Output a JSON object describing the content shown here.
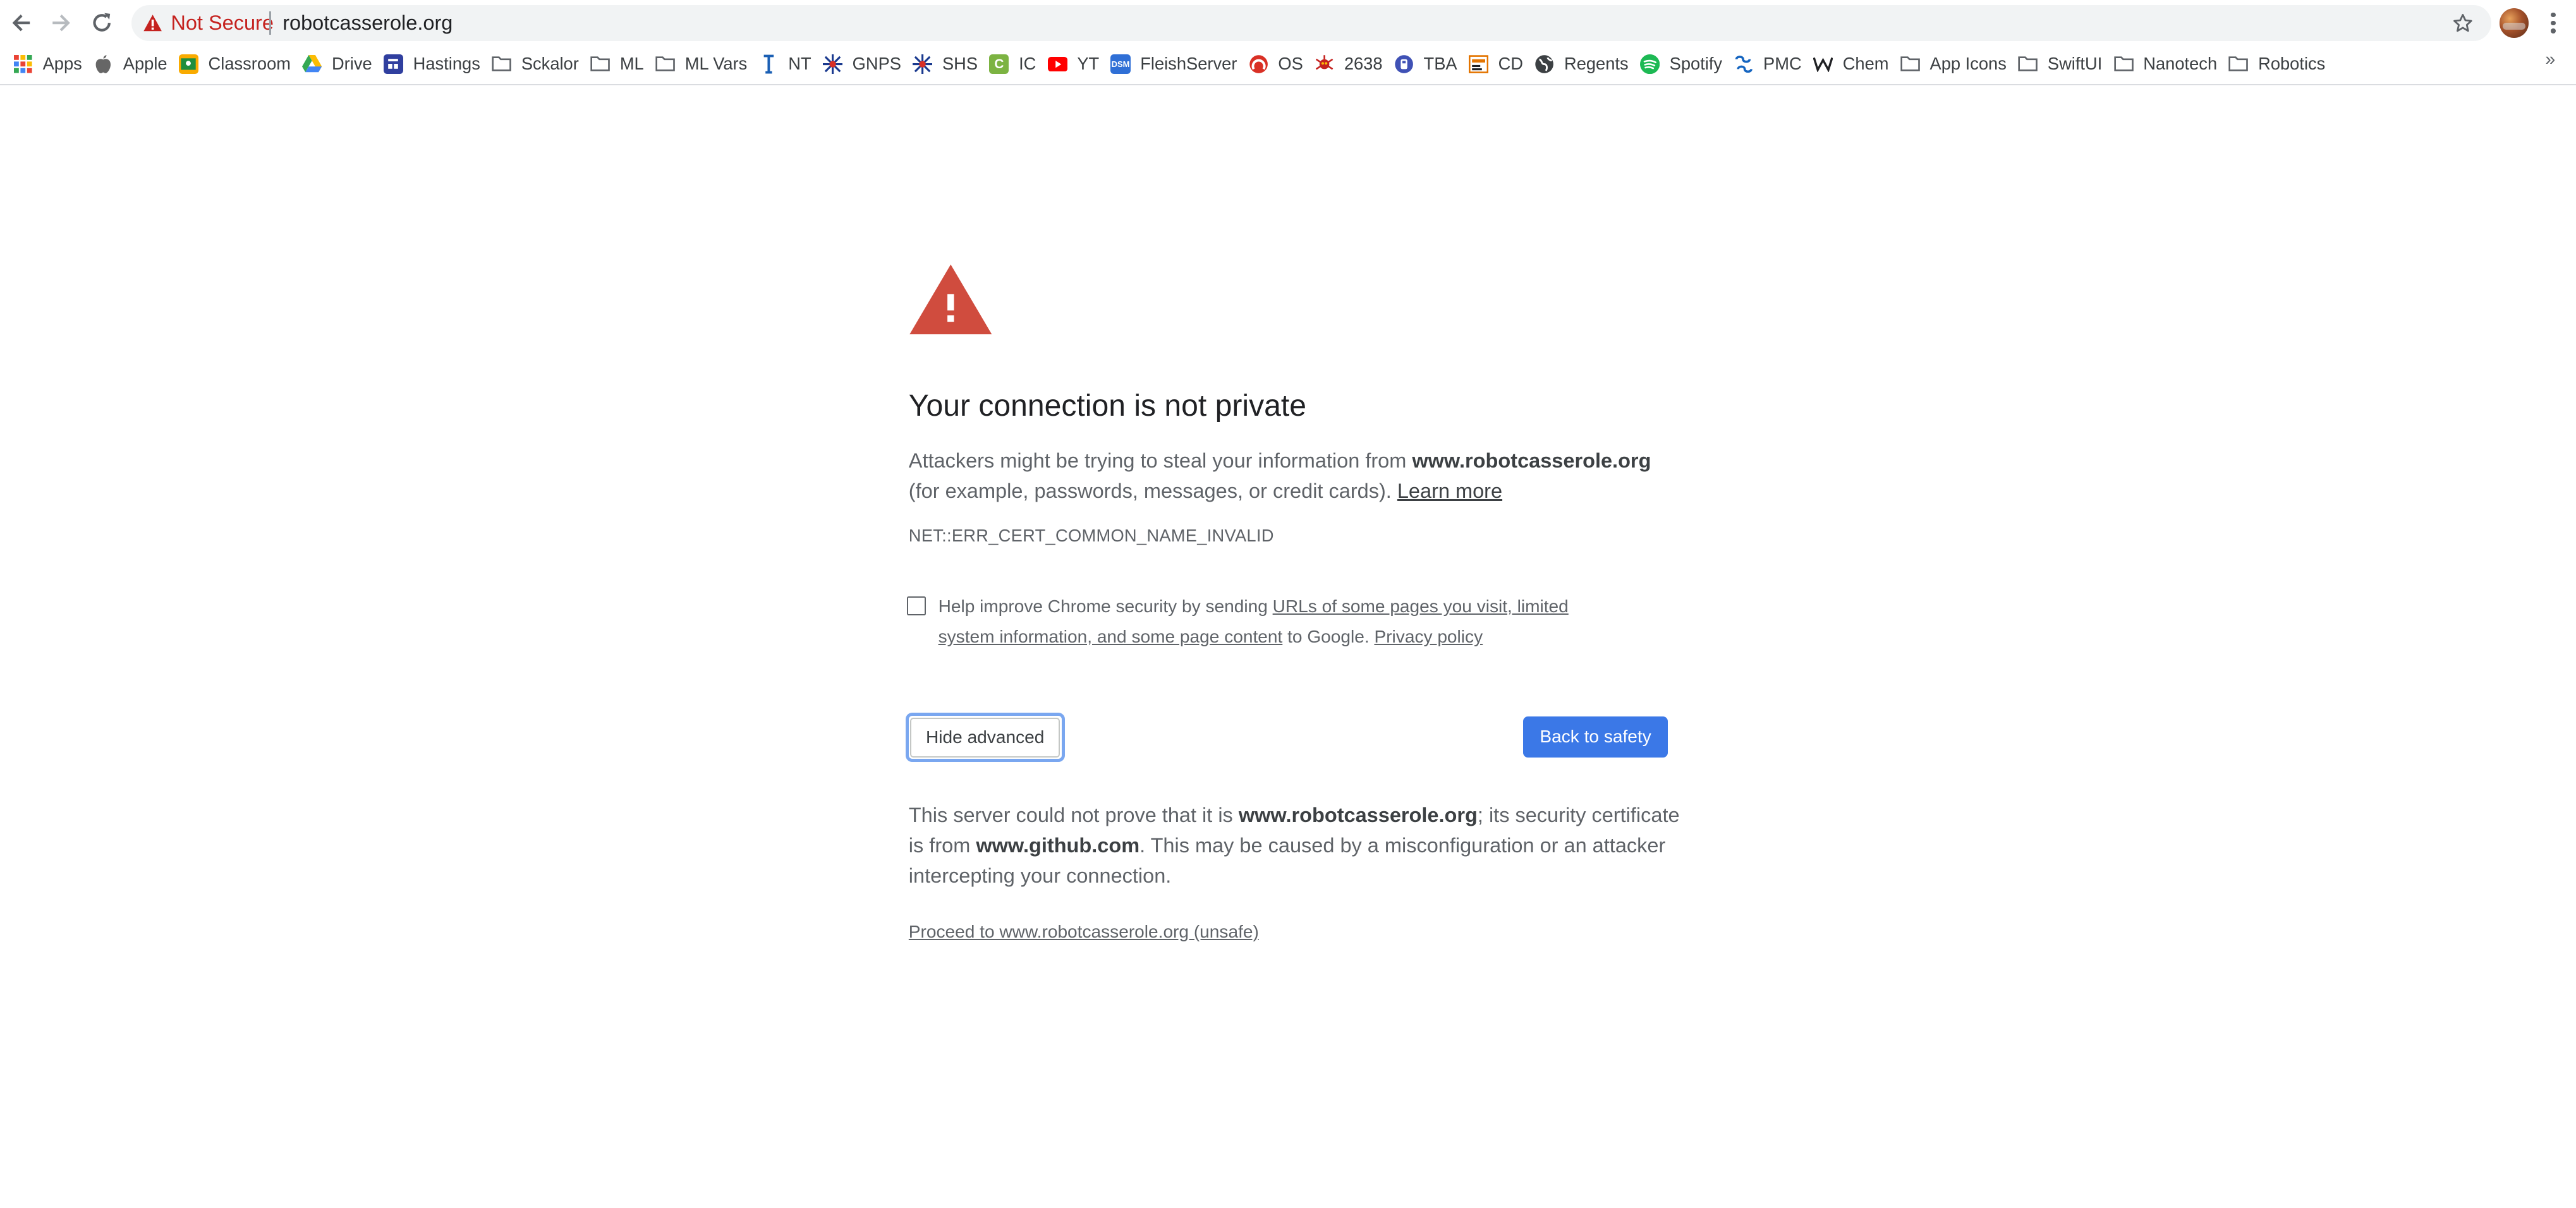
{
  "colors": {
    "not_secure": "#c5221f",
    "warning_red": "#d04c3e",
    "primary_button": "#3b78e7",
    "focus_ring": "#7aa7f0"
  },
  "toolbar": {
    "back_icon": "arrow-left",
    "forward_icon": "arrow-right",
    "reload_icon": "reload",
    "security_label": "Not Secure",
    "url": "robotcasserole.org",
    "bookmark_icon": "star-outline",
    "menu_icon": "vertical-dots"
  },
  "bookmarks": [
    {
      "label": "Apps",
      "icon": "apps-grid"
    },
    {
      "label": "Apple",
      "icon": "apple-logo"
    },
    {
      "label": "Classroom",
      "icon": "classroom"
    },
    {
      "label": "Drive",
      "icon": "drive"
    },
    {
      "label": "Hastings",
      "icon": "hastings"
    },
    {
      "label": "Sckalor",
      "icon": "folder"
    },
    {
      "label": "ML",
      "icon": "folder"
    },
    {
      "label": "ML Vars",
      "icon": "folder"
    },
    {
      "label": "NT",
      "icon": "nt"
    },
    {
      "label": "GNPS",
      "icon": "gnps"
    },
    {
      "label": "SHS",
      "icon": "shs"
    },
    {
      "label": "IC",
      "icon": "ic"
    },
    {
      "label": "YT",
      "icon": "youtube"
    },
    {
      "label": "FleishServer",
      "icon": "dsm"
    },
    {
      "label": "OS",
      "icon": "os"
    },
    {
      "label": "2638",
      "icon": "2638"
    },
    {
      "label": "TBA",
      "icon": "tba"
    },
    {
      "label": "CD",
      "icon": "cd"
    },
    {
      "label": "Regents",
      "icon": "globe"
    },
    {
      "label": "Spotify",
      "icon": "spotify"
    },
    {
      "label": "PMC",
      "icon": "pmc"
    },
    {
      "label": "Chem",
      "icon": "chem"
    },
    {
      "label": "App Icons",
      "icon": "folder"
    },
    {
      "label": "SwiftUI",
      "icon": "folder"
    },
    {
      "label": "Nanotech",
      "icon": "folder"
    },
    {
      "label": "Robotics",
      "icon": "folder"
    }
  ],
  "bookmarks_overflow": "»",
  "interstitial": {
    "warning_icon": "warning-triangle",
    "heading": "Your connection is not private",
    "intro_1": "Attackers might be trying to steal your information from ",
    "intro_domain": "www.robotcasserole.org",
    "intro_2": " (for example, passwords, messages, or credit cards). ",
    "learn_more": "Learn more",
    "error_code": "NET::ERR_CERT_COMMON_NAME_INVALID",
    "optin_1": "Help improve Chrome security by sending ",
    "optin_link": "URLs of some pages you visit, limited system information, and some page content",
    "optin_2": " to Google. ",
    "privacy_policy": "Privacy policy",
    "hide_advanced": "Hide advanced",
    "back_to_safety": "Back to safety",
    "details_1": "This server could not prove that it is ",
    "details_domain": "www.robotcasserole.org",
    "details_2": "; its security certificate is from ",
    "details_issuer": "www.github.com",
    "details_3": ". This may be caused by a misconfiguration or an attacker intercepting your connection.",
    "proceed": "Proceed to www.robotcasserole.org (unsafe)"
  }
}
